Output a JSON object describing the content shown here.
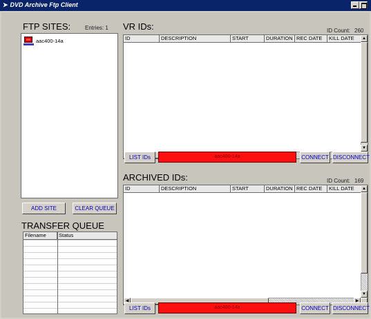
{
  "window": {
    "title": "DVD Archive Ftp Client"
  },
  "ftp_sites": {
    "title": "FTP SITES:",
    "entries_label": "Entries: 1",
    "items": [
      {
        "label": "aac400-14a"
      }
    ],
    "add_site_label": "ADD SITE",
    "clear_queue_label": "CLEAR QUEUE"
  },
  "transfer_queue": {
    "title": "TRANSFER QUEUE",
    "columns": [
      "Filename",
      "Status"
    ]
  },
  "vr_ids": {
    "title": "VR IDs:",
    "count_label": "ID Count:",
    "count": "260",
    "columns": [
      "ID",
      "DESCRIPTION",
      "START",
      "DURATION",
      "REC DATE",
      "KILL DATE"
    ],
    "list_ids_label": "LIST IDs",
    "connection": "aac400-14a",
    "connect_label": "CONNECT",
    "disconnect_label": "DISCONNECT"
  },
  "archived_ids": {
    "title": "ARCHIVED IDs:",
    "count_label": "ID Count:",
    "count": "169",
    "columns": [
      "ID",
      "DESCRIPTION",
      "START",
      "DURATION",
      "REC DATE",
      "KILL DATE"
    ],
    "list_ids_label": "LIST IDs",
    "connection": "aac400-14a",
    "connect_label": "CONNECT",
    "disconnect_label": "DISCONNECT"
  },
  "colors": {
    "titlebar": "#0a246a",
    "connection_bar": "#ff1010",
    "button_text": "#0000c0"
  }
}
